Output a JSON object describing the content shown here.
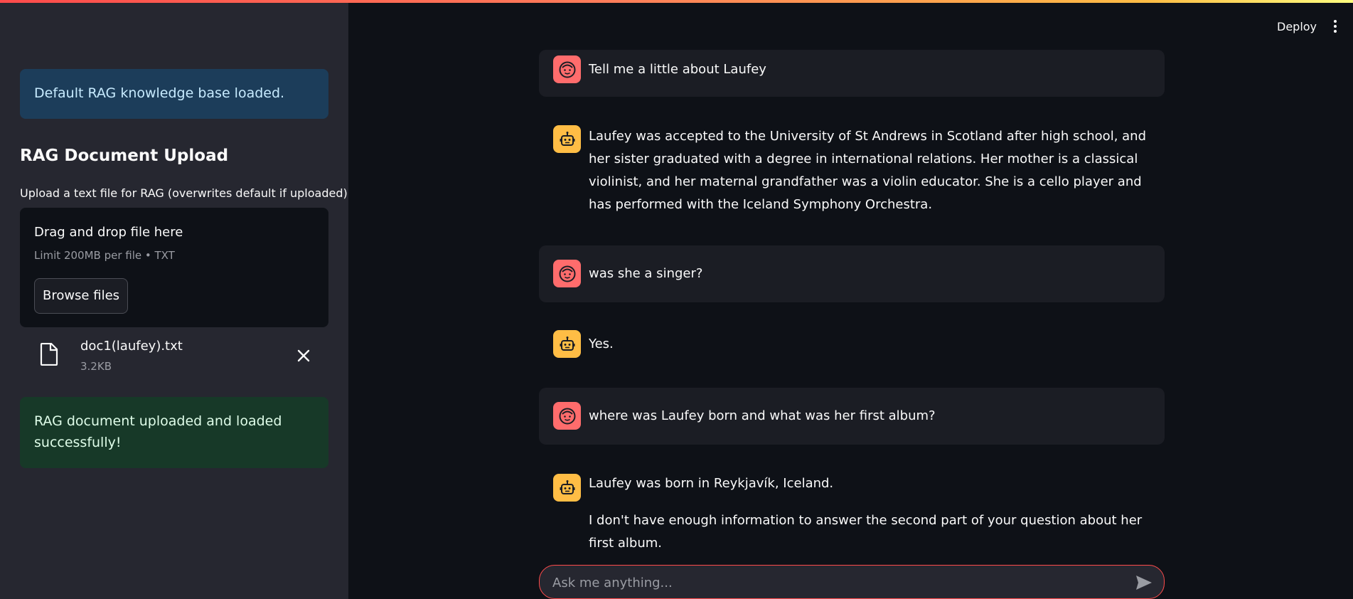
{
  "header": {
    "deploy_label": "Deploy"
  },
  "sidebar": {
    "info_alert": "Default RAG knowledge base loaded.",
    "section_title": "RAG Document Upload",
    "upload_label": "Upload a text file for RAG (overwrites default if uploaded)",
    "dropzone": {
      "title": "Drag and drop file here",
      "limit": "Limit 200MB per file • TXT",
      "browse_label": "Browse files"
    },
    "uploaded_file": {
      "name": "doc1(laufey).txt",
      "size": "3.2KB"
    },
    "success_alert": "RAG document uploaded and loaded successfully!"
  },
  "chat": {
    "messages": [
      {
        "role": "user",
        "text": "Tell me a little about Laufey"
      },
      {
        "role": "assistant",
        "text": "Laufey was accepted to the University of St Andrews in Scotland after high school, and her sister graduated with a degree in international relations. Her mother is a classical violinist, and her maternal grandfather was a violin educator. She is a cello player and has performed with the Iceland Symphony Orchestra."
      },
      {
        "role": "user",
        "text": "was she a singer?"
      },
      {
        "role": "assistant",
        "text": "Yes."
      },
      {
        "role": "user",
        "text": "where was Laufey born and what was her first album?"
      },
      {
        "role": "assistant",
        "text": "Laufey was born in Reykjavík, Iceland.",
        "text2": "I don't have enough information to answer the second part of your question about her first album."
      }
    ],
    "input_placeholder": "Ask me anything..."
  },
  "colors": {
    "accent": "#ff4b4b",
    "user_avatar": "#ff6c6c",
    "bot_avatar": "#ffbd45",
    "info_bg": "#1c3d5a",
    "success_bg": "#173928"
  }
}
